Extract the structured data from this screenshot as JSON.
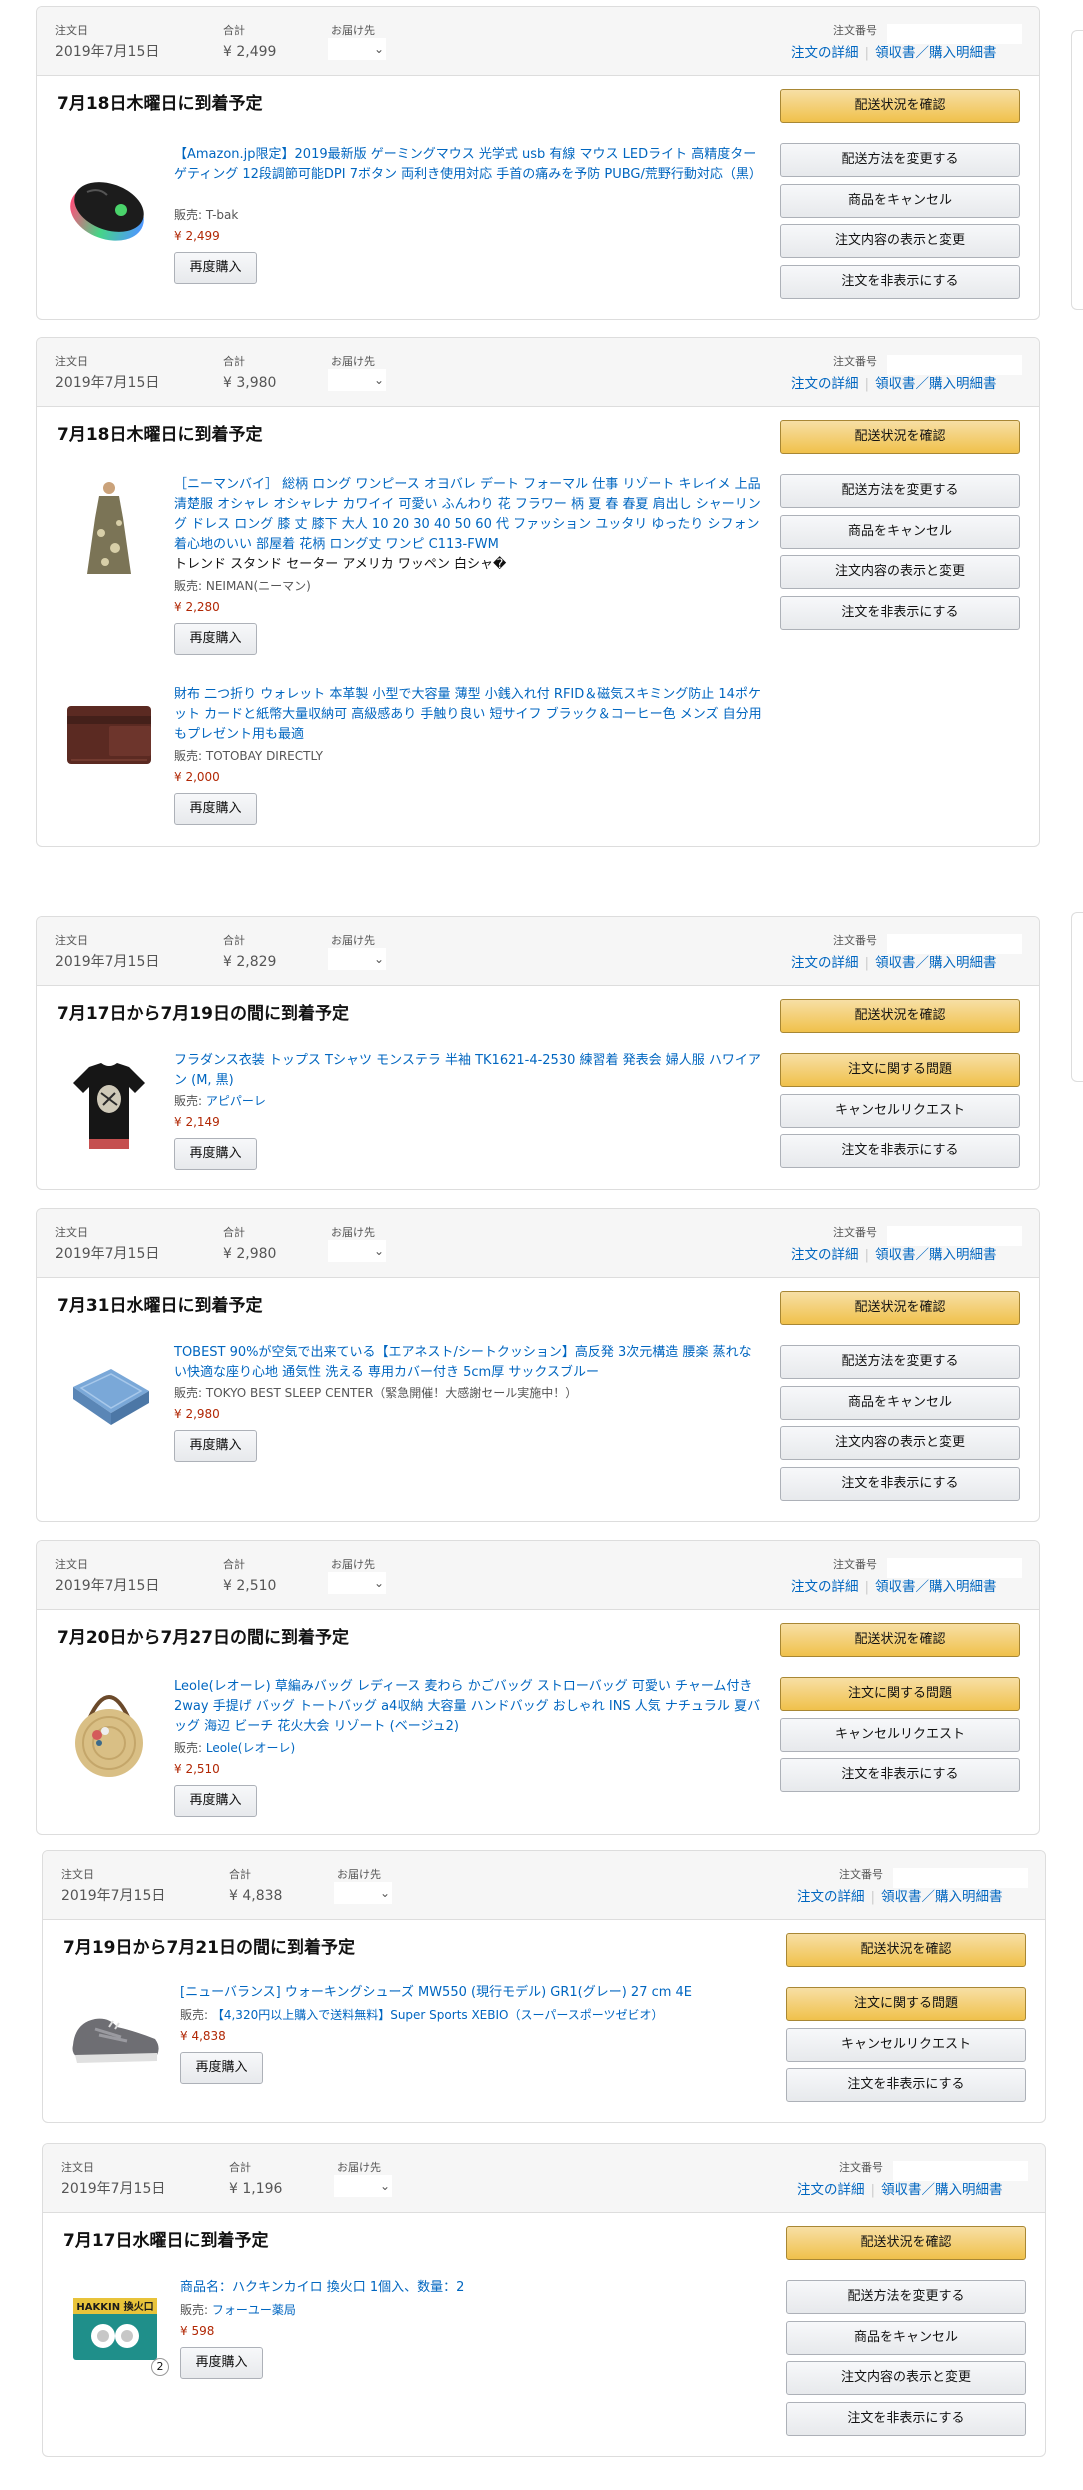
{
  "labels": {
    "order_date": "注文日",
    "total": "合計",
    "ship_to": "お届け先",
    "order_number": "注文番号",
    "order_details": "注文の詳細",
    "receipt": "領収書／購入明細書",
    "rebuy": "再度購入",
    "track": "配送状況を確認",
    "change_ship": "配送方法を変更する",
    "cancel": "商品をキャンセル",
    "view_change": "注文内容の表示と変更",
    "hide": "注文を非表示にする",
    "problem": "注文に関する問題",
    "cancel_req": "キャンセルリクエスト",
    "chevron": "⌄"
  },
  "orders": [
    {
      "date": "2019年7月15日",
      "total": "¥ 2,499",
      "eta": "7月18日木曜日に到着予定",
      "items": [
        {
          "icon": "gaming-mouse-image",
          "title": "【Amazon.jp限定】2019最新版 ゲーミングマウス 光学式 usb 有線 マウス LEDライト 高精度ターゲティング 12段調節可能DPI 7ボタン 両利き使用対応 手首の痛みを予防 PUBG/荒野行動対応（黒）",
          "seller": "販売: T-bak",
          "price": "¥ 2,499"
        }
      ]
    },
    {
      "date": "2019年7月15日",
      "total": "¥ 3,980",
      "eta": "7月18日木曜日に到着予定",
      "items": [
        {
          "icon": "dress-image",
          "title": "［ニーマンバイ］ 総柄 ロング ワンピース オヨバレ デート フォーマル 仕事 リゾート キレイメ 上品 清楚服 オシャレ オシャレナ カワイイ 可愛い ふんわり 花 フラワー 柄 夏 春 春夏 肩出し シャーリング ドレス ロング 膝 丈 膝下 大人 10 20 30 40 50 60 代 ファッション ユッタリ ゆったり シフォン 着心地のいい 部屋着 花柄 ロング丈 ワンピ C113-FWM",
          "extra": "トレンド スタンド セーター アメリカ ワッペン 白シャ�",
          "seller": "販売: NEIMAN(ニーマン)",
          "price": "¥ 2,280"
        },
        {
          "icon": "wallet-image",
          "title": "財布 二つ折り ウォレット 本革製 小型で大容量 薄型 小銭入れ付 RFID＆磁気スキミング防止 14ポケット カードと紙幣大量収納可 高級感あり 手触り良い 短サイフ ブラック＆コーヒー色 メンズ 自分用もプレゼント用も最適",
          "seller": "販売: TOTOBAY DIRECTLY",
          "price": "¥ 2,000"
        }
      ]
    },
    {
      "date": "2019年7月15日",
      "total": "¥ 2,829",
      "eta": "7月17日から7月19日の間に到着予定",
      "items": [
        {
          "icon": "tshirt-image",
          "title": "フラダンス衣装 トップス Tシャツ モンステラ 半袖 TK1621-4-2530 練習着 発表会 婦人服 ハワイアン (M, 黒)",
          "seller": "販売: ",
          "seller_link": "アピパーレ",
          "price": "¥ 2,149"
        }
      ]
    },
    {
      "date": "2019年7月15日",
      "total": "¥ 2,980",
      "eta": "7月31日水曜日に到着予定",
      "items": [
        {
          "icon": "seat-cushion-image",
          "title": "TOBEST 90%が空気で出来ている【エアネスト/シートクッション】高反発 3次元構造 腰楽 蒸れない快適な座り心地 通気性 洗える 専用カバー付き 5cm厚 サックスブルー",
          "seller": "販売: TOKYO BEST SLEEP CENTER（緊急開催！大感謝セール実施中！）",
          "price": "¥ 2,980"
        }
      ]
    },
    {
      "date": "2019年7月15日",
      "total": "¥ 2,510",
      "eta": "7月20日から7月27日の間に到着予定",
      "items": [
        {
          "icon": "straw-bag-image",
          "title": "Leole(レオーレ) 草編みバッグ レディース 麦わら かごバッグ ストローバッグ 可愛い チャーム付き 2way 手提げ バッグ トートバッグ a4収納 大容量 ハンドバッグ おしゃれ INS 人気 ナチュラル 夏バッグ 海辺 ビーチ 花火大会 リゾート (ベージュ2)",
          "seller": "販売: ",
          "seller_link": "Leole(レオーレ)",
          "price": "¥ 2,510"
        }
      ]
    },
    {
      "date": "2019年7月15日",
      "total": "¥ 4,838",
      "eta": "7月19日から7月21日の間に到着予定",
      "items": [
        {
          "icon": "sneaker-image",
          "title": "[ニューバランス] ウォーキングシューズ MW550 (現行モデル) GR1(グレー) 27 cm 4E",
          "seller": "販売: ",
          "seller_link": "【4,320円以上購入で送料無料】Super Sports XEBIO（スーパースポーツゼビオ）",
          "price": "¥ 4,838"
        }
      ]
    },
    {
      "date": "2019年7月15日",
      "total": "¥ 1,196",
      "eta": "7月17日水曜日に到着予定",
      "items": [
        {
          "icon": "hand-warmer-image",
          "title": "商品名：ハクキンカイロ 換火口 1個入、数量：2",
          "seller": "販売: ",
          "seller_link": "フォーユー薬局",
          "price": "¥ 598",
          "qty": "2",
          "pack_text": "HAKKIN 換火口"
        }
      ]
    }
  ]
}
